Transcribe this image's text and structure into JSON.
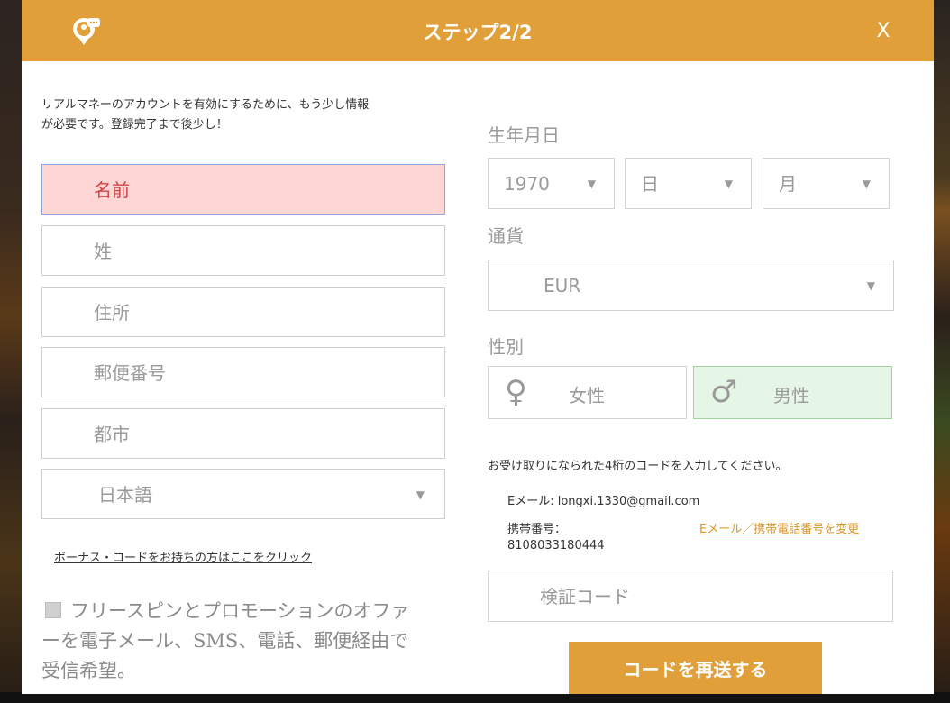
{
  "colors": {
    "accent": "#e09f38",
    "error_bg": "#ffd6d6",
    "selected_bg": "#e6f6e6",
    "link": "#d9982f"
  },
  "header": {
    "title": "ステップ2/2",
    "close_label": "X",
    "logo_icon": "support-chat-icon"
  },
  "intro": {
    "line1": "リアルマネーのアカウントを有効にするために、もう少し情報",
    "line2": "が必要です。登録完了まで後少し！"
  },
  "form": {
    "first_name": "名前",
    "last_name": "姓",
    "address": "住所",
    "postcode": "郵便番号",
    "city": "都市",
    "language": "日本語"
  },
  "bonus_link": "ボーナス・コードをお持ちの方はここをクリック",
  "optin": {
    "line1": "フリースピンとプロモーションのオファ",
    "line2": "ーを電子メール、SMS、電話、郵便経由で",
    "line3": "受信希望。"
  },
  "birthdate": {
    "label": "生年月日",
    "year": "1970",
    "day": "日",
    "month": "月"
  },
  "currency": {
    "label": "通貨",
    "value": "EUR"
  },
  "gender": {
    "label": "性別",
    "female": "女性",
    "male": "男性",
    "female_symbol": "♀",
    "male_symbol": "♂",
    "selected": "male"
  },
  "verification": {
    "instruction": "お受け取りになられた4桁のコードを入力してください。",
    "email_line": "Eメール: longxi.1330@gmail.com",
    "phone_label": "携帯番号：",
    "phone_number": "8108033180444",
    "change_link": "Eメール／携帯電話番号を変更",
    "code_placeholder": "検証コード",
    "resend_label": "コードを再送する"
  },
  "icons": {
    "dropdown": "▼"
  }
}
